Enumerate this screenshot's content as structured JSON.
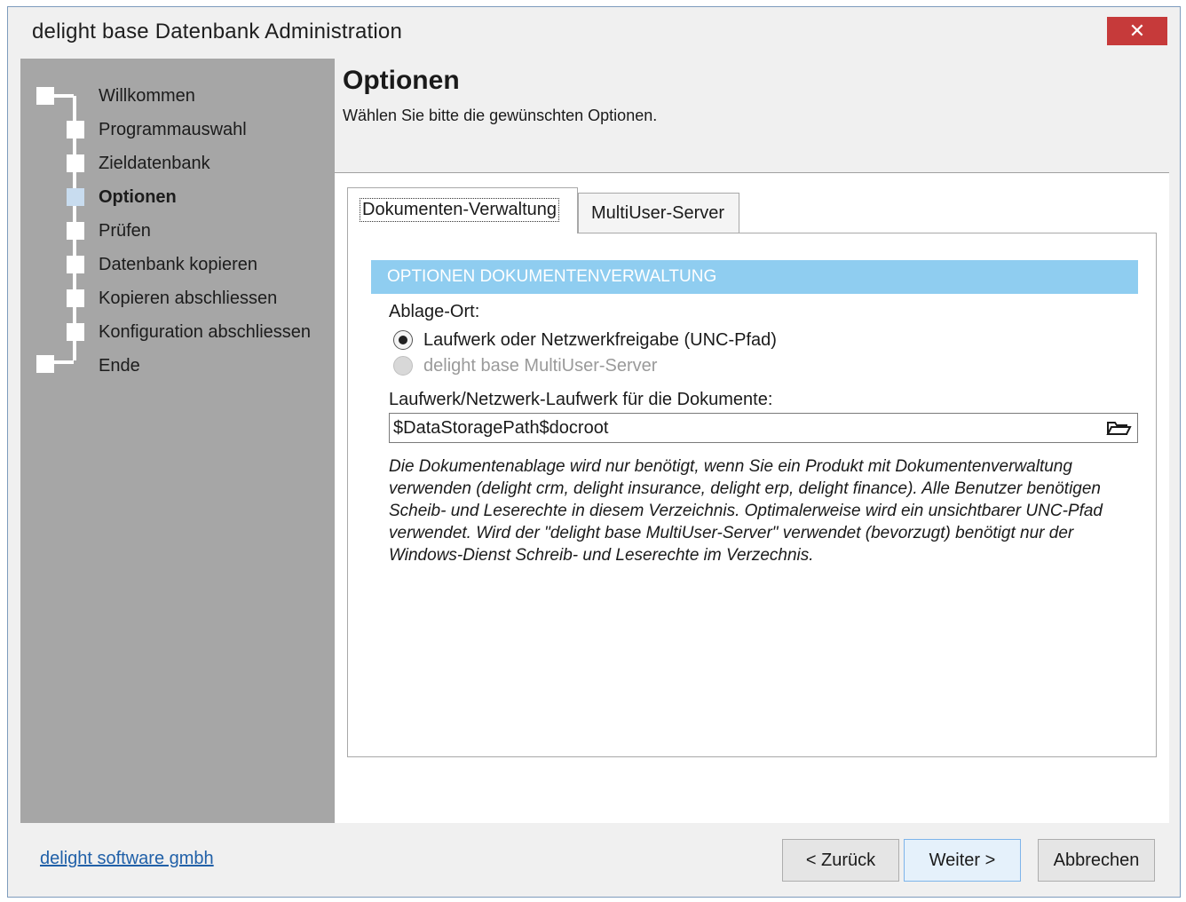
{
  "window": {
    "title": "delight base Datenbank Administration",
    "close_glyph": "✕"
  },
  "steps": [
    {
      "label": "Willkommen"
    },
    {
      "label": "Programmauswahl"
    },
    {
      "label": "Zieldatenbank"
    },
    {
      "label": "Optionen",
      "active": true
    },
    {
      "label": "Prüfen"
    },
    {
      "label": "Datenbank kopieren"
    },
    {
      "label": "Kopieren abschliessen"
    },
    {
      "label": "Konfiguration abschliessen"
    },
    {
      "label": "Ende"
    }
  ],
  "header": {
    "title": "Optionen",
    "subtitle": "Wählen Sie bitte die gewünschten Optionen."
  },
  "tabs": [
    {
      "label": "Dokumenten-Verwaltung",
      "selected": true
    },
    {
      "label": "MultiUser-Server",
      "selected": false
    }
  ],
  "panel": {
    "section_title": "OPTIONEN DOKUMENTENVERWALTUNG",
    "storage_label": "Ablage-Ort:",
    "radio_options": [
      {
        "label": "Laufwerk oder Netzwerkfreigabe (UNC-Pfad)",
        "checked": true,
        "enabled": true
      },
      {
        "label": "delight base MultiUser-Server",
        "checked": false,
        "enabled": false
      }
    ],
    "path_label": "Laufwerk/Netzwerk-Laufwerk für die Dokumente:",
    "path_value": "$DataStoragePath$docroot",
    "note": "Die Dokumentenablage wird nur benötigt, wenn Sie ein Produkt mit Dokumentenverwaltung verwenden (delight crm, delight insurance, delight erp, delight finance). Alle Benutzer benötigen Scheib- und Leserechte in diesem Verzeichnis. Optimalerweise wird ein unsichtbarer UNC-Pfad verwendet. Wird der \"delight base MultiUser-Server\" verwendet (bevorzugt) benötigt nur der Windows-Dienst Schreib- und Leserechte im Verzechnis."
  },
  "footer": {
    "company_link": "delight software gmbh",
    "back_label": "< Zurück",
    "next_label": "Weiter >",
    "cancel_label": "Abbrechen"
  },
  "colors": {
    "section_bar": "#8fcdf0",
    "close_button": "#c63a3a",
    "left_panel": "#a6a6a6",
    "link": "#2060a8"
  }
}
